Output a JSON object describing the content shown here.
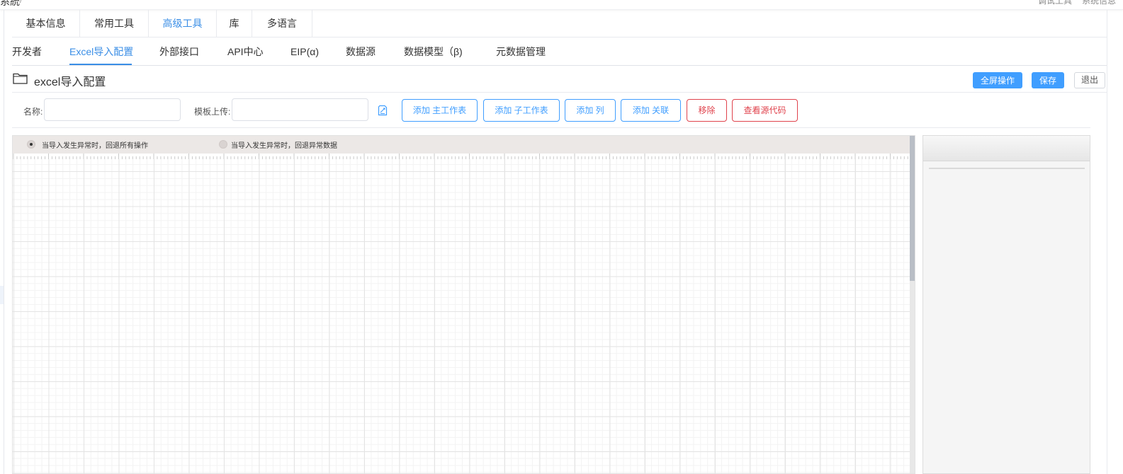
{
  "header": {
    "breadcrumb": "系統",
    "breadcrumb_sep": "/",
    "tools": [
      "调试工具",
      "系统信息"
    ]
  },
  "tabs_primary": [
    {
      "label": "基本信息"
    },
    {
      "label": "常用工具"
    },
    {
      "label": "高级工具",
      "active": true
    },
    {
      "label": "库"
    },
    {
      "label": "多语言"
    }
  ],
  "tabs_secondary": [
    {
      "label": "开发者"
    },
    {
      "label": "Excel导入配置",
      "active": true
    },
    {
      "label": "外部接口"
    },
    {
      "label": "API中心"
    },
    {
      "label": "EIP(α)"
    },
    {
      "label": "数据源"
    },
    {
      "label": "数据模型（β)"
    },
    {
      "label": "元数据管理"
    }
  ],
  "page": {
    "title": "excel导入配置",
    "title_icon": "folder-icon",
    "fullscreen_label": "全屏操作",
    "save_label": "保存",
    "exit_label": "退出"
  },
  "form": {
    "name_label": "名称:",
    "name_value": "",
    "template_label": "模板上传:",
    "template_value": "",
    "upload_icon": "upload-file-icon",
    "add_main_sheet": "添加 主工作表",
    "add_sub_sheet": "添加 子工作表",
    "add_column": "添加 列",
    "add_relation": "添加 关联",
    "remove": "移除",
    "view_source": "查看源代码"
  },
  "options": {
    "rollback_all": "当导入发生异常时，回退所有操作",
    "rollback_error": "当导入发生异常时，回退异常数据",
    "selected": "rollback_all"
  },
  "colors": {
    "accent": "#409eff",
    "danger": "#e0434d",
    "active_tab": "#3a8ee6"
  }
}
